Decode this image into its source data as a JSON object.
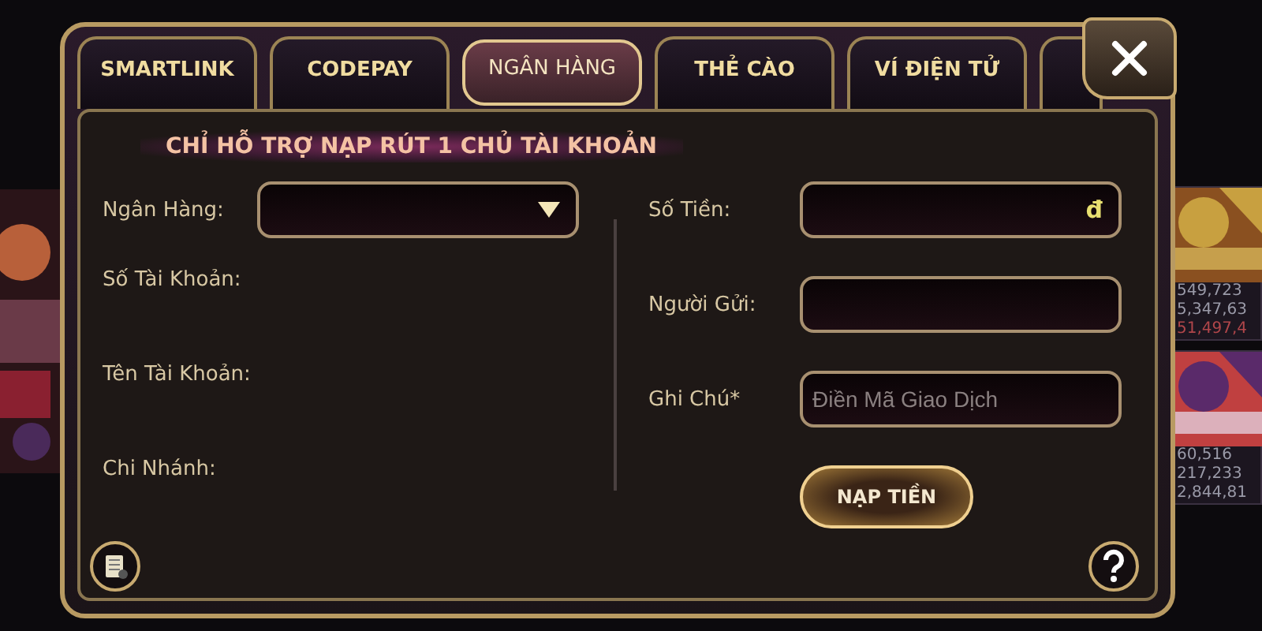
{
  "tabs": [
    {
      "label": "SMARTLINK",
      "selected": false
    },
    {
      "label": "CODEPAY",
      "selected": false
    },
    {
      "label": "NGÂN HÀNG",
      "selected": true
    },
    {
      "label": "THẺ CÀO",
      "selected": false
    },
    {
      "label": "VÍ ĐIỆN TỬ",
      "selected": false
    }
  ],
  "notice": "CHỈ HỖ TRỢ NẠP RÚT 1 CHỦ TÀI KHOẢN",
  "bank_info": [
    {
      "kind": "dropdown",
      "label": "Ngân Hàng:"
    },
    {
      "kind": "text",
      "label": "Số Tài Khoản:"
    },
    {
      "kind": "text",
      "label": "Tên Tài Khoản:"
    },
    {
      "kind": "text",
      "label": "Chi Nhánh:"
    }
  ],
  "deposit_form": [
    {
      "label": "Số Tiền:",
      "suffix": "đ"
    },
    {
      "label": "Người Gửi:"
    },
    {
      "label": "Ghi Chú*",
      "placeholder": "Điền Mã Giao Dịch"
    }
  ],
  "submit_button": "NẠP TIỀN",
  "lobby_stats": [
    [
      {
        "text": "549,723",
        "kind": "plain"
      },
      {
        "text": "5,347,63",
        "kind": "plain"
      },
      {
        "text": "51,497,4",
        "kind": "jackpot"
      }
    ],
    [
      {
        "text": "60,516",
        "kind": "plain"
      },
      {
        "text": "217,233",
        "kind": "plain"
      },
      {
        "text": "2,844,81",
        "kind": "plain"
      }
    ]
  ]
}
